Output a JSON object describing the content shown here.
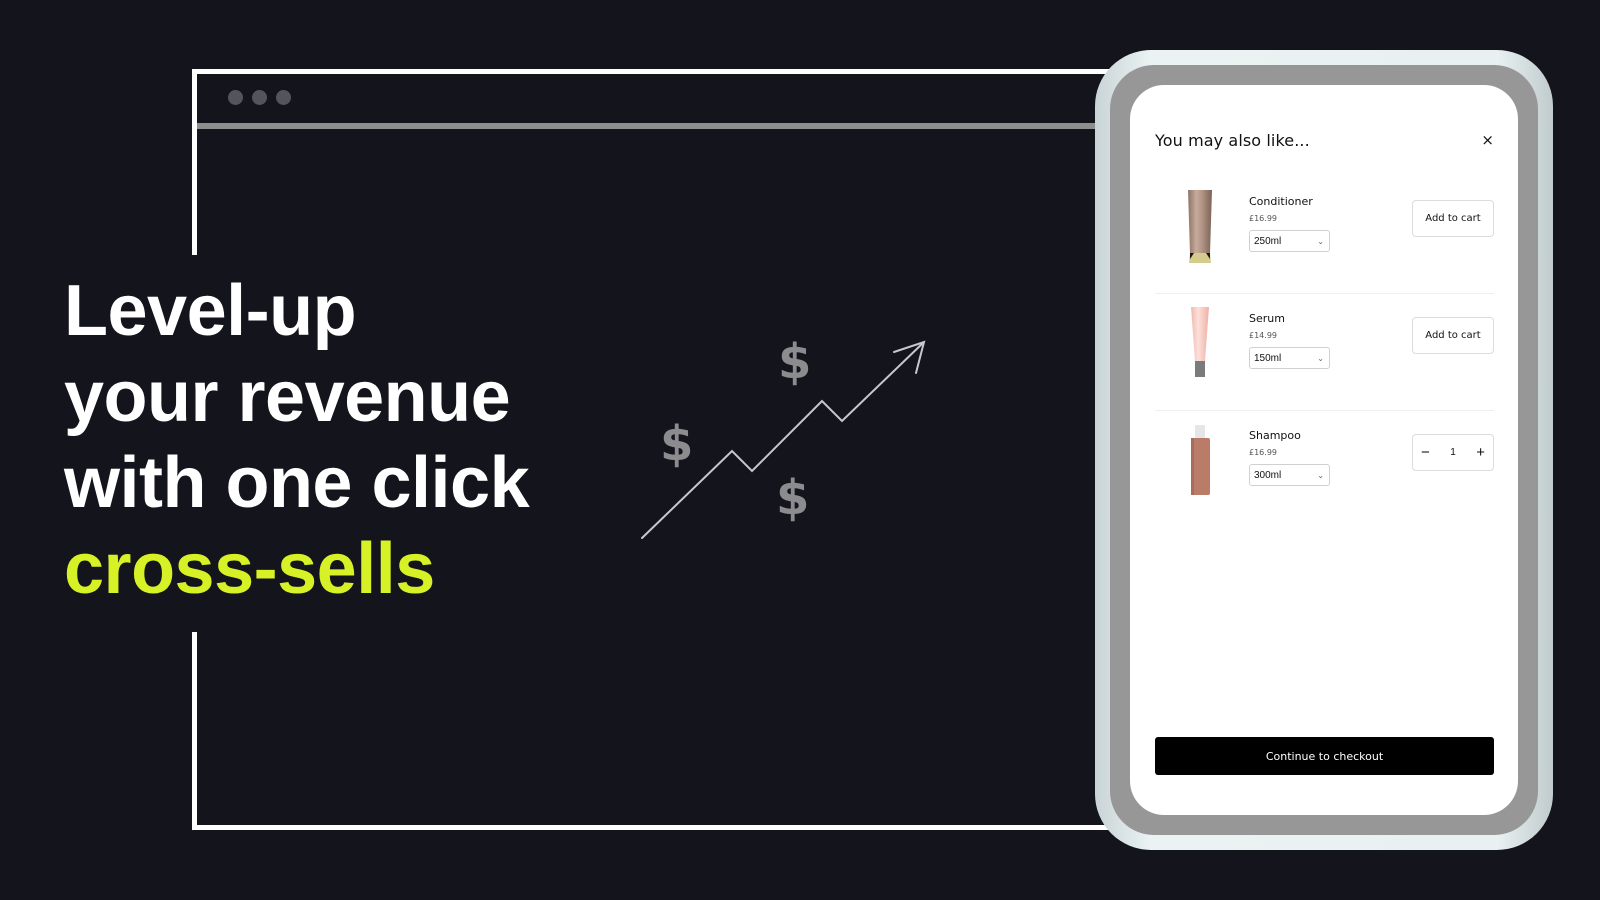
{
  "colors": {
    "background": "#14141d",
    "accent": "#d7f127",
    "headline": "#ffffff",
    "checkout_button": "#000000"
  },
  "headline": {
    "lines": [
      "Level-up",
      "your revenue",
      "with one click"
    ],
    "accent_line": "cross-sells"
  },
  "growth_graphic": {
    "icon": "trending-up-arrow-icon",
    "dollar_symbol": "$"
  },
  "drawer": {
    "title": "You may also like...",
    "close_icon": "×",
    "products": [
      {
        "name": "Conditioner",
        "price": "£16.99",
        "variant": "250ml",
        "action": "add_to_cart",
        "action_label": "Add to cart",
        "image": "conditioner-tube"
      },
      {
        "name": "Serum",
        "price": "£14.99",
        "variant": "150ml",
        "action": "add_to_cart",
        "action_label": "Add to cart",
        "image": "serum-tube"
      },
      {
        "name": "Shampoo",
        "price": "£16.99",
        "variant": "300ml",
        "action": "quantity",
        "quantity": "1",
        "minus": "−",
        "plus": "+",
        "image": "shampoo-bottle"
      }
    ],
    "chevron": "⌄",
    "checkout_label": "Continue to checkout"
  }
}
